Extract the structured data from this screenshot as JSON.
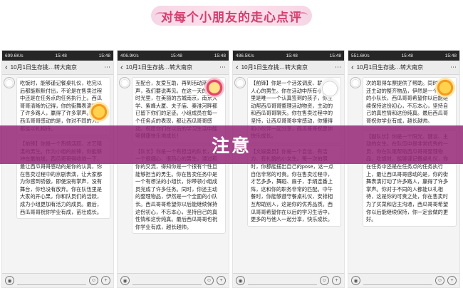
{
  "banner": {
    "title": "对每个小朋友的走心点评"
  },
  "overlay": {
    "text": "注意"
  },
  "panels": [
    {
      "status_left": "699.6K/s",
      "status_center": "15:48",
      "status_right": "15:48",
      "chat_title": "10月1日生存挑…转大南京",
      "messages": [
        "吃饭时，能够谨记餐桌礼仪，吃完以后都能默默付出，不论是在售卖过程中还是在任务点的任务执行上。西瓜哥哥清晰的记得，你的街舞表演打动了许多路人，赢得了许多掌声。最让西瓜哥哥感动的是，你对不同的人，都能以礼相待。",
        "【前锋】你是一个热情活跃、才艺精湛的男生。作为小组的前锋，你能够冲在最前线，西瓜哥哥得收敛一下，最让西瓜哥哥感动的是你的认真，你在售卖过程中的京剧表演，让大家都为你感到骄傲，即使没有掌声，没有舞台，你也没有放弃。你在队伍里是大家的开心果，你和队员们的活跃，成为小组更加有活力的成员。最后，西瓜哥哥祝你学业有成，苗壮成长。"
      ]
    },
    {
      "status_left": "406.9K/s",
      "status_center": "15:48",
      "status_right": "15:48",
      "chat_title": "10月1日生存挑…转大南京",
      "messages": [
        "互配合，友爱互助，再到活动渐入尾声，我们要说再见。在这一天的美好时光里，在美丽的古城南京，南京大学、紫峰大厦、夫子庙、秦淮河畔都已留下你们的足迹。小组成员在每一个任务点的表现，都让西瓜哥哥感动。祝愿你们在以后的学习生活中能够健康快乐地成长！",
        "【队长】你是一个有担当的队长，是一个很细心、很热心的男生，通过和你的交流，得知你是一个很有个性且能够担当的男生。你在售卖任务中是一个有想法的小组长，你带领小组成员完成了许多任务。同时，你还主动的整理物品，伊然是一个全面的小队长。西瓜哥哥希望你以后能继续保持这份初心，不忘本心，坚持自己的真性情和这份纯真。最后西瓜哥哥也祝你学业有成，越长越帅。"
      ]
    },
    {
      "status_left": "486.5K/s",
      "status_center": "15:48",
      "status_right": "15:48",
      "chat_title": "10月1日生存挑…转大南京",
      "messages": [
        "【前锋】你是一个活泼调皮、聪慧、人心的男生。你在活动中所有小朋友里是唯一一个认真签到的孩子，你主动帮西瓜哥哥整理活动物资，主动的和西瓜哥哥聊天。你在售卖过程中的坚持，让西瓜哥哥非常感动，你懂得和小伙伴一起分享，西瓜哥哥祝愿你快乐成长。",
        "【文娱委员】你是一个自信、有活力、有礼貌的小女生。每一次拍照时，你都能摆出自己的pose，这一点自信非常的可贵。你在售卖过程中，才艺多多，舞蹈、扇子，手绢连番上阵，这和你的职务非常的匹配。中午餐时，你能够遵守餐桌礼仪，安排相互帮助别人，这是你的优秀品质。西瓜哥哥希望你在以后的学习生活中，更多的与他人一起分享，快乐成长。"
      ]
    },
    {
      "status_left": "551.6K/s",
      "status_center": "15:48",
      "status_right": "15:48",
      "chat_title": "10月1日生存挑…转大南京",
      "messages": [
        "次的取得车票提供了帮助。同时，你还主动的整齐物品，伊然是一个全面的小队长，西瓜哥哥希望你以后能继续保持这份初心，不忘本心，坚持自己的真性情和这份纯真。最后西瓜哥哥祝你学业有成，越长越帅。",
        "【副队长】你是一个阳光、健谈、主动的女生。在队伍中是非常优秀的一员，你在队尾帮助西瓜哥哥整理物品，吃饭时，能够谨记餐桌礼仪，你在任务中还是在任务点的任务执行上，最让西瓜哥哥感动的是，你的街舞表演打动了许多路人，赢得了许多掌声。你对于不同的人都能以礼相待，这是你的可贵之处，你在售卖时为了买菜和店主沟通，西瓜哥哥希望你以后能继续保持，你一定会做的更好。"
      ]
    }
  ],
  "inputbar": {
    "voice_icon": "voice-icon",
    "emoji_icon": "emoji-icon",
    "plus_icon": "plus-icon"
  }
}
